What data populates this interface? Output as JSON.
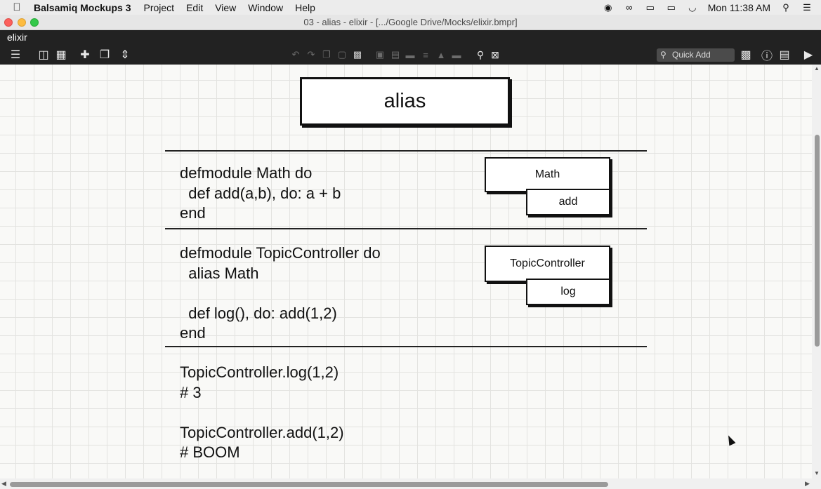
{
  "menubar": {
    "app_name": "Balsamiq Mockups 3",
    "items": [
      "Project",
      "Edit",
      "View",
      "Window",
      "Help"
    ],
    "clock": "Mon 11:38 AM"
  },
  "window": {
    "title": "03 - alias - elixir - [.../Google Drive/Mocks/elixir.bmpr]"
  },
  "project": {
    "name": "elixir"
  },
  "toolbar": {
    "quick_add_placeholder": "Quick Add"
  },
  "canvas": {
    "title": "alias",
    "section1_code": "defmodule Math do\n  def add(a,b), do: a + b\nend",
    "section2_code": "defmodule TopicController do\n  alias Math\n\n  def log(), do: add(1,2)\nend",
    "section3_code": "TopicController.log(1,2)\n# 3\n\nTopicController.add(1,2)\n# BOOM",
    "math_box": {
      "module": "Math",
      "function": "add"
    },
    "topic_box": {
      "module": "TopicController",
      "function": "log"
    }
  }
}
